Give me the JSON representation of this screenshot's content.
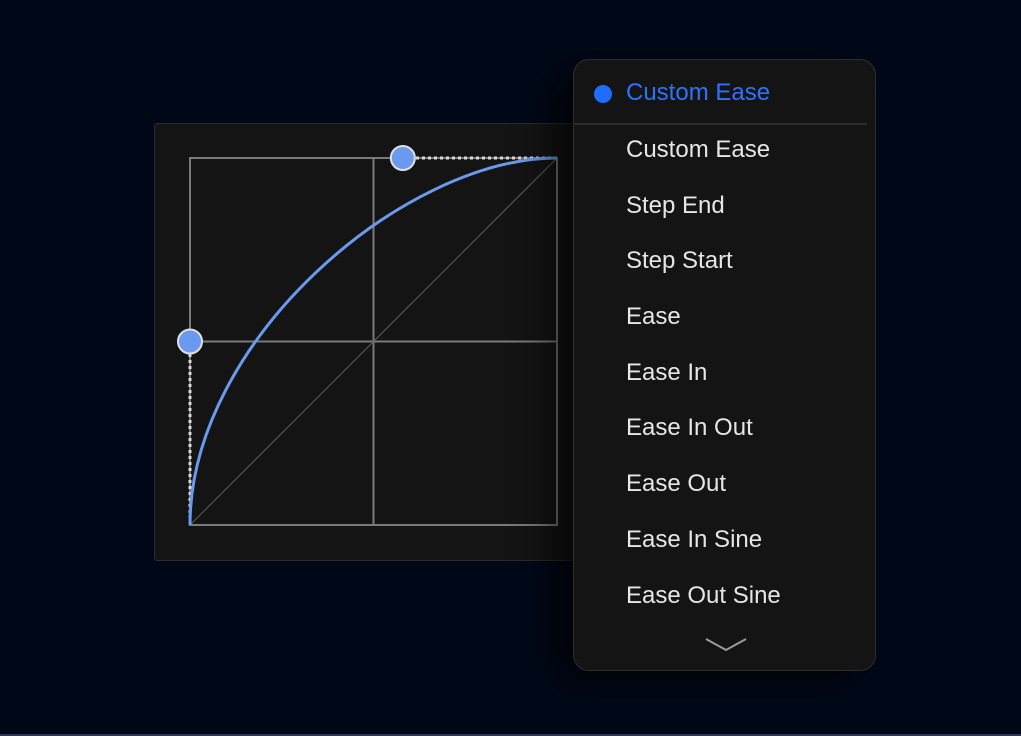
{
  "dropdown": {
    "selected": {
      "label": "Custom Ease",
      "indicator_color": "#1f6dff"
    },
    "items": [
      {
        "label": "Custom Ease"
      },
      {
        "label": "Step End"
      },
      {
        "label": "Step Start"
      },
      {
        "label": "Ease"
      },
      {
        "label": "Ease In"
      },
      {
        "label": "Ease In Out"
      },
      {
        "label": "Ease Out"
      },
      {
        "label": "Ease In Sine"
      },
      {
        "label": "Ease Out Sine"
      }
    ],
    "scroll_icon": "chevron-down-icon"
  },
  "curve_editor": {
    "bezier": [
      0,
      0.5,
      0.58,
      1
    ],
    "curve_color": "#6a9af0",
    "handle_color": "#6a9af0"
  },
  "theme": {
    "background": "#000818",
    "panel": "#141414",
    "accent": "#2b73ff"
  }
}
